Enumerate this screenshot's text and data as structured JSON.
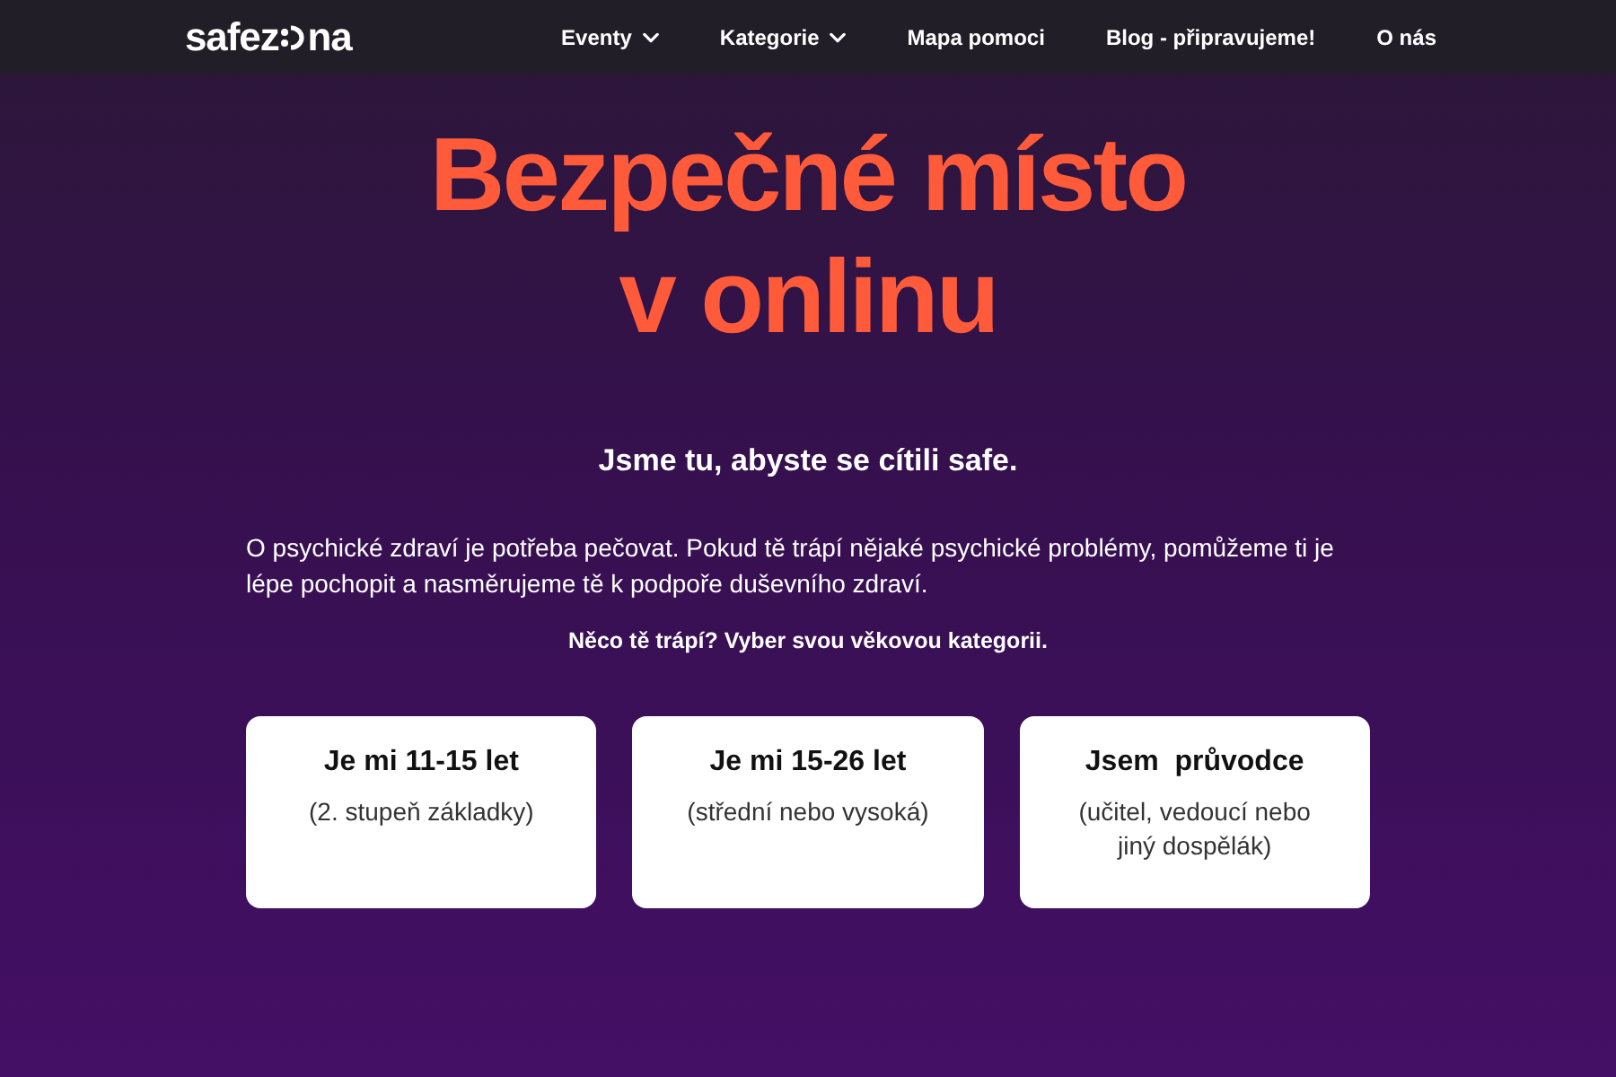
{
  "header": {
    "logo": {
      "before": "safez",
      "after": "na"
    },
    "nav": [
      {
        "label": "Eventy",
        "dropdown": true
      },
      {
        "label": "Kategorie",
        "dropdown": true
      },
      {
        "label": "Mapa pomoci",
        "dropdown": false
      },
      {
        "label": "Blog - připravujeme!",
        "dropdown": false
      },
      {
        "label": "O nás",
        "dropdown": false
      }
    ]
  },
  "hero": {
    "title_lines": [
      "Bezpečné místo",
      "v onlinu"
    ],
    "subtitle": "Jsme tu, abyste se cítili safe.",
    "intro": "O psychické zdraví je potřeba pečovat. Pokud tě trápí nějaké psychické problémy, pomůžeme ti je lépe pochopit a nasměrujeme tě k podpoře duševního zdraví.",
    "prompt": "Něco tě trápí? Vyber svou věkovou kategorii."
  },
  "categories": [
    {
      "title": "Je mi 11-15 let",
      "detail": "(2. stupeň základky)"
    },
    {
      "title": "Je mi 15-26 let",
      "detail": "(střední nebo vysoká)"
    },
    {
      "title": "Jsem  průvodce",
      "detail": "(učitel, vedoucí nebo jiný dospělák)"
    }
  ]
}
